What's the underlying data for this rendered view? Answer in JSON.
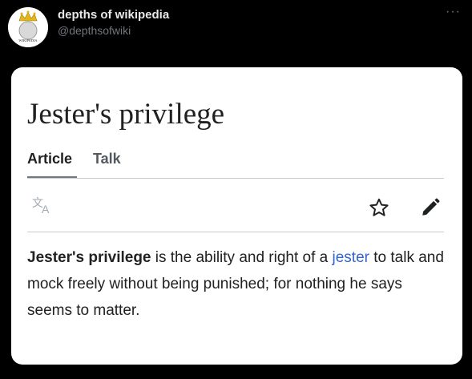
{
  "tweet": {
    "display_name": "depths of wikipedia",
    "handle": "@depthsofwiki",
    "more_label": "···",
    "avatar_text": "WIKIPEDIA"
  },
  "article": {
    "title": "Jester's privilege",
    "tabs": [
      {
        "label": "Article",
        "active": true
      },
      {
        "label": "Talk",
        "active": false
      }
    ],
    "icons": [
      "language-icon",
      "star-icon",
      "pencil-icon"
    ],
    "paragraph": {
      "bold_lead": "Jester's privilege",
      "text_1": " is the ability and right of a ",
      "link_text": "jester",
      "text_2": " to talk and mock freely without being punished; for nothing he says seems to matter."
    }
  },
  "colors": {
    "link": "#3366cc",
    "text": "#202122",
    "background": "#000000"
  }
}
